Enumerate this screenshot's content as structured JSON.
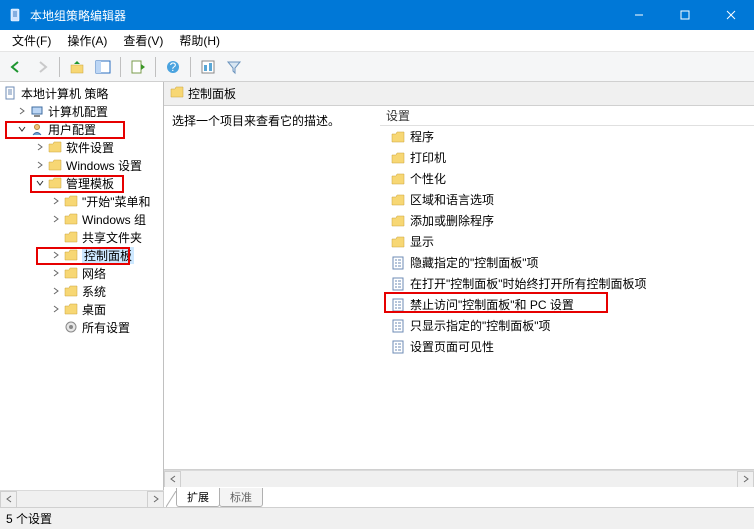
{
  "window": {
    "title": "本地组策略编辑器"
  },
  "menu": {
    "file": "文件(F)",
    "action": "操作(A)",
    "view": "查看(V)",
    "help": "帮助(H)"
  },
  "tree": {
    "root": "本地计算机 策略",
    "computer_cfg": "计算机配置",
    "user_cfg": "用户配置",
    "software": "软件设置",
    "windows_settings": "Windows 设置",
    "admin_templates": "管理模板",
    "start_menu": "\"开始\"菜单和",
    "windows_components": "Windows 组",
    "shared_folders": "共享文件夹",
    "control_panel": "控制面板",
    "network": "网络",
    "system": "系统",
    "desktop": "桌面",
    "all_settings": "所有设置"
  },
  "header": {
    "title": "控制面板"
  },
  "desc": {
    "hint": "选择一个项目来查看它的描述。"
  },
  "list": {
    "column": "设置",
    "items": [
      "程序",
      "打印机",
      "个性化",
      "区域和语言选项",
      "添加或删除程序",
      "显示",
      "隐藏指定的\"控制面板\"项",
      "在打开\"控制面板\"时始终打开所有控制面板项",
      "禁止访问\"控制面板\"和 PC 设置",
      "只显示指定的\"控制面板\"项",
      "设置页面可见性"
    ]
  },
  "tabs": {
    "extended": "扩展",
    "standard": "标准"
  },
  "status": {
    "text": "5 个设置"
  }
}
